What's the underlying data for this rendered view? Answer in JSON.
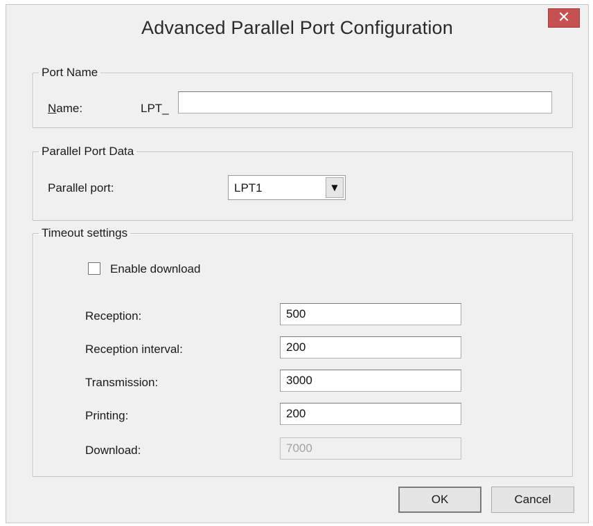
{
  "window": {
    "title": "Advanced Parallel Port Configuration",
    "close_glyph": "✕"
  },
  "port_name": {
    "group_label": "Port Name",
    "name_label_underlined": "N",
    "name_label_rest": "ame:",
    "prefix": "LPT_",
    "value": ""
  },
  "parallel_data": {
    "group_label": "Parallel Port Data",
    "port_label": "Parallel port:",
    "port_value": "LPT1",
    "dropdown_glyph": "▼"
  },
  "timeout": {
    "group_label": "Timeout settings",
    "enable_download_label": "Enable download",
    "enable_download_checked": false,
    "fields": [
      {
        "label": "Reception:",
        "value": "500",
        "enabled": true
      },
      {
        "label": "Reception interval:",
        "value": "200",
        "enabled": true
      },
      {
        "label": "Transmission:",
        "value": "3000",
        "enabled": true
      },
      {
        "label": "Printing:",
        "value": "200",
        "enabled": true
      },
      {
        "label": "Download:",
        "value": "7000",
        "enabled": false
      }
    ]
  },
  "buttons": {
    "ok": "OK",
    "cancel": "Cancel"
  },
  "colors": {
    "dialog_bg": "#f0f0f0",
    "close_button": "#c75050",
    "disabled_text": "#a2a2a2"
  }
}
